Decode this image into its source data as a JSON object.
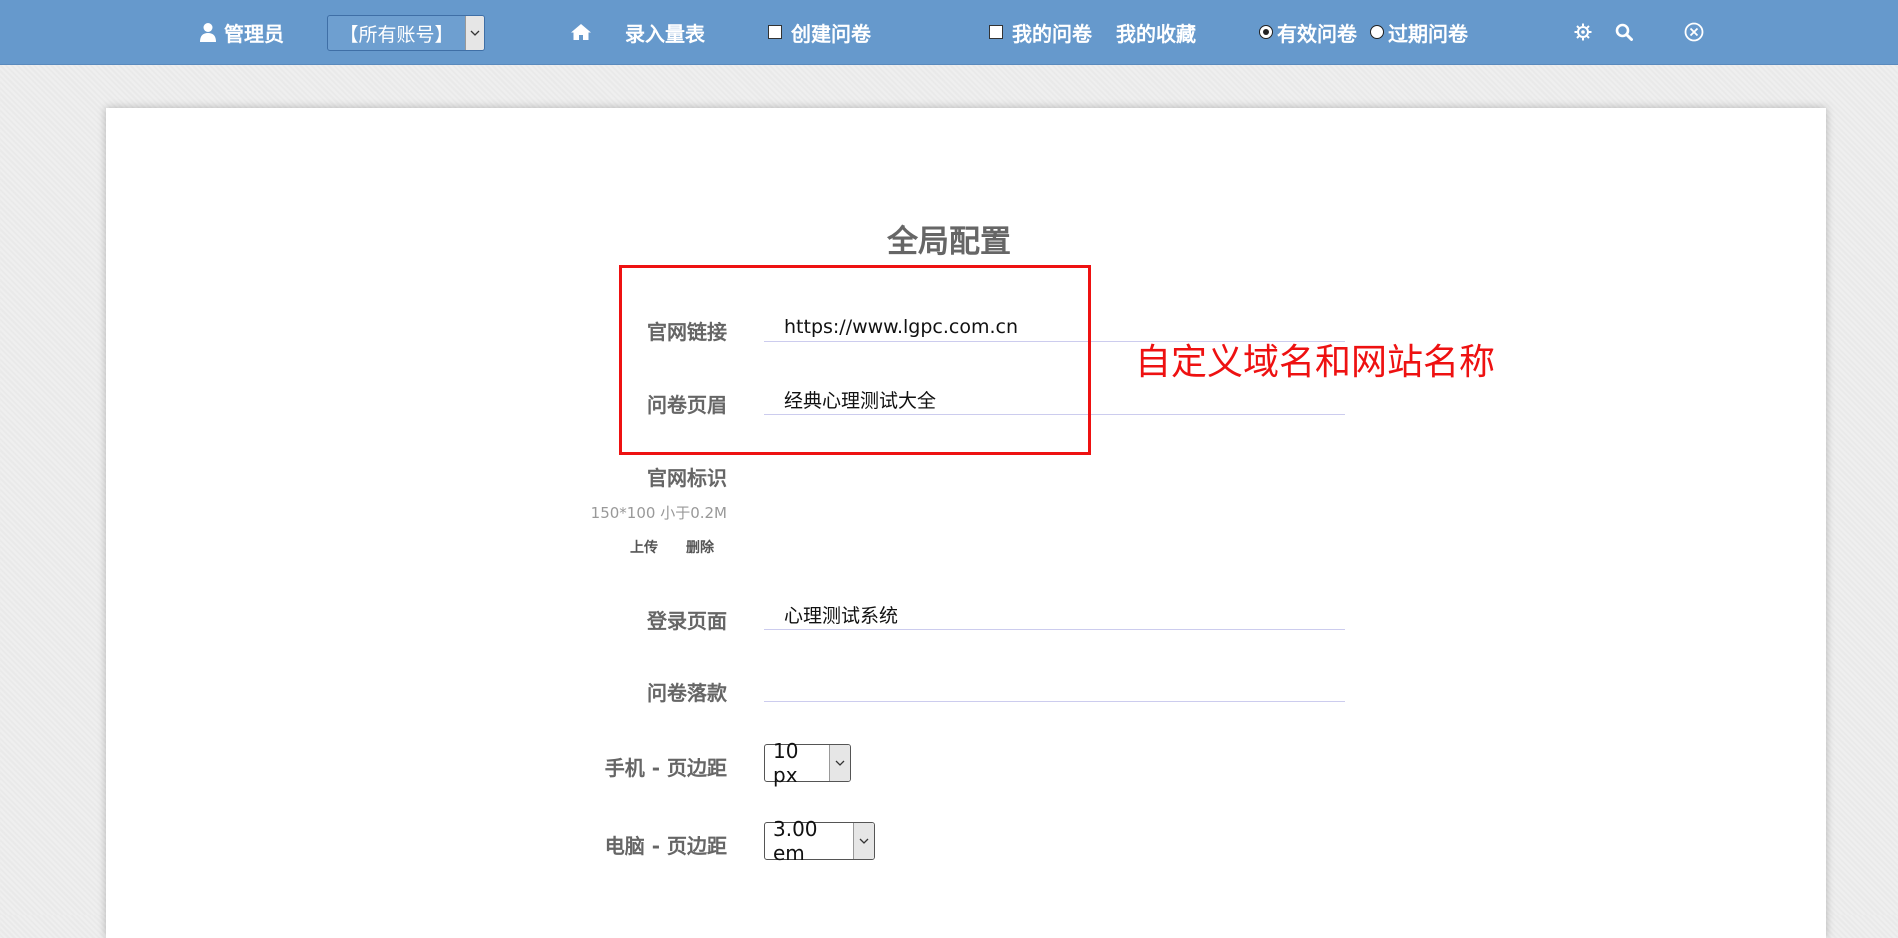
{
  "topbar": {
    "user_label": "管理员",
    "account_select": {
      "value": "【所有账号】"
    },
    "home_icon": "home-icon",
    "entry_label": "录入量表",
    "create_label": "创建问卷",
    "my_surveys_label": "我的问卷",
    "favorites_label": "我的收藏",
    "valid_label": "有效问卷",
    "expired_label": "过期问卷",
    "selected_filter": "valid"
  },
  "page": {
    "title": "全局配置",
    "site_link": {
      "label": "官网链接",
      "value": "https://www.lgpc.com.cn"
    },
    "header": {
      "label": "问卷页眉",
      "value": "经典心理测试大全"
    },
    "logo": {
      "label": "官网标识",
      "hint": "150*100  小于0.2M",
      "upload_label": "上传",
      "delete_label": "删除"
    },
    "login": {
      "label": "登录页面",
      "value": "心理测试系统"
    },
    "footer": {
      "label": "问卷落款",
      "value": ""
    },
    "mobile_margin": {
      "label": "手机 - 页边距",
      "value": "10 px"
    },
    "desktop_margin": {
      "label": "电脑 - 页边距",
      "value": "3.00 em"
    }
  },
  "annotation": {
    "text": "自定义域名和网站名称",
    "color": "#ee1111"
  },
  "colors": {
    "topbar": "#6699cc",
    "label": "#666666",
    "field_underline": "#ccccee"
  }
}
